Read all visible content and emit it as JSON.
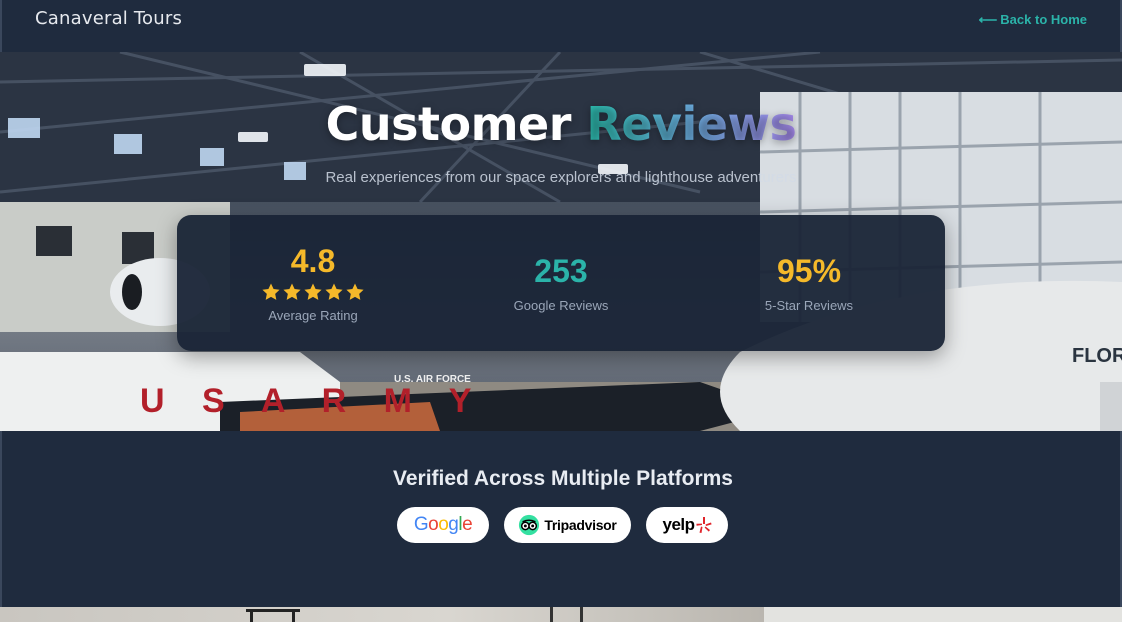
{
  "header": {
    "brand": "Canaveral Tours",
    "back_arrow": "⟵",
    "back_label": "Back to Home"
  },
  "hero": {
    "title_main": "Customer",
    "title_accent": "Reviews",
    "subtitle": "Real experiences from our space explorers and lighthouse adventurers",
    "background_text": {
      "army": "U S A R M Y",
      "air_force": "U.S. AIR FORCE",
      "florida": "FLORI"
    }
  },
  "stats": [
    {
      "value": "4.8",
      "label": "Average Rating",
      "stars": 5
    },
    {
      "value": "253",
      "label": "Google Reviews"
    },
    {
      "value": "95%",
      "label": "5-Star Reviews"
    }
  ],
  "verified": {
    "title": "Verified Across Multiple Platforms",
    "platforms": [
      {
        "name": "Google",
        "icon": "google-logo"
      },
      {
        "name": "Tripadvisor",
        "icon": "tripadvisor-owl-icon"
      },
      {
        "name": "yelp",
        "icon": "yelp-burst-icon"
      }
    ]
  },
  "colors": {
    "accent_teal": "#2bb3a9",
    "accent_gold": "#f5b92a",
    "navy": "#1f2b3e",
    "card": "#192436"
  }
}
